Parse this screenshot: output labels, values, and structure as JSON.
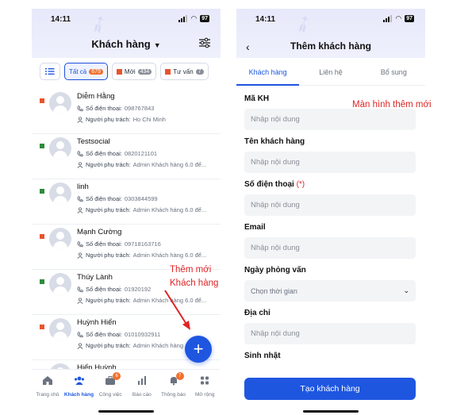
{
  "colors": {
    "accent": "#1e56e0",
    "badge": "#f2702b",
    "annotation": "#e02424",
    "status_new": "#e8542b",
    "status_consult": "#2e8b3a"
  },
  "left_screen": {
    "status": {
      "time": "14:11",
      "battery": "97"
    },
    "title": "Khách hàng",
    "filters": [
      {
        "label": "Tất cả",
        "count": "679",
        "active": true
      },
      {
        "label": "Mới",
        "count": "434",
        "color": "#e8542b"
      },
      {
        "label": "Tư vấn",
        "count": "7",
        "color": "#e8542b"
      }
    ],
    "customers": [
      {
        "name": "Diễm Hằng",
        "phone_label": "Số điện thoại:",
        "phone": "098767843",
        "owner_label": "Người phụ trách:",
        "owner": "Ho Chi Minh",
        "status_color": "#e8542b"
      },
      {
        "name": "Testsocial",
        "phone_label": "Số điện thoại:",
        "phone": "0820121101",
        "owner_label": "Người phụ trách:",
        "owner": "Admin Khách hàng 6.0 để...",
        "status_color": "#2e8b3a"
      },
      {
        "name": "linh",
        "phone_label": "Số điện thoại:",
        "phone": "0303844599",
        "owner_label": "Người phụ trách:",
        "owner": "Admin Khách hàng 6.0 để...",
        "status_color": "#2e8b3a"
      },
      {
        "name": "Mạnh Cường",
        "phone_label": "Số điện thoại:",
        "phone": "09718163716",
        "owner_label": "Người phụ trách:",
        "owner": "Admin Khách hàng 6.0 để...",
        "status_color": "#e8542b"
      },
      {
        "name": "Thúy Lành",
        "phone_label": "Số điện thoại:",
        "phone": "01920192",
        "owner_label": "Người phụ trách:",
        "owner": "Admin Khách hàng 6.0 để...",
        "status_color": "#2e8b3a"
      },
      {
        "name": "Huỳnh Hiển",
        "phone_label": "Số điện thoại:",
        "phone": "01010932911",
        "owner_label": "Người phụ trách:",
        "owner": "Admin Khách hàng",
        "status_color": "#e8542b"
      },
      {
        "name": "Hiển Huỳnh",
        "phone_label": "",
        "phone": "",
        "owner_label": "",
        "owner": "",
        "status_color": "#e8542b"
      }
    ],
    "fab_label": "+",
    "tabbar": [
      {
        "label": "Trang chủ",
        "icon": "home-icon"
      },
      {
        "label": "Khách hàng",
        "icon": "users-icon",
        "active": true
      },
      {
        "label": "Công việc",
        "icon": "briefcase-icon",
        "badge": "6"
      },
      {
        "label": "Báo cáo",
        "icon": "chart-icon"
      },
      {
        "label": "Thông báo",
        "icon": "bell-icon",
        "badge": "7"
      },
      {
        "label": "Mở rộng",
        "icon": "grid-icon"
      }
    ]
  },
  "right_screen": {
    "status": {
      "time": "14:11",
      "battery": "97"
    },
    "title": "Thêm khách hàng",
    "tabs": [
      {
        "label": "Khách hàng",
        "active": true
      },
      {
        "label": "Liên hệ"
      },
      {
        "label": "Bổ sung"
      }
    ],
    "fields": [
      {
        "label": "Mã KH",
        "placeholder": "Nhập nội dung"
      },
      {
        "label": "Tên khách hàng",
        "placeholder": "Nhập nội dung"
      },
      {
        "label": "Số điện thoại",
        "required_mark": "(*)",
        "placeholder": "Nhập nội dung"
      },
      {
        "label": "Email",
        "placeholder": "Nhập nội dung"
      },
      {
        "label": "Ngày phỏng vấn",
        "placeholder": "Chọn thời gian",
        "type": "date"
      },
      {
        "label": "Địa chỉ",
        "placeholder": "Nhập nội dung"
      },
      {
        "label": "Sinh nhật",
        "placeholder": ""
      }
    ],
    "submit_label": "Tạo khách hàng"
  },
  "annotations": {
    "right_note": "Màn hình thêm mới",
    "left_note_line1": "Thêm mới",
    "left_note_line2": "Khách hàng"
  }
}
